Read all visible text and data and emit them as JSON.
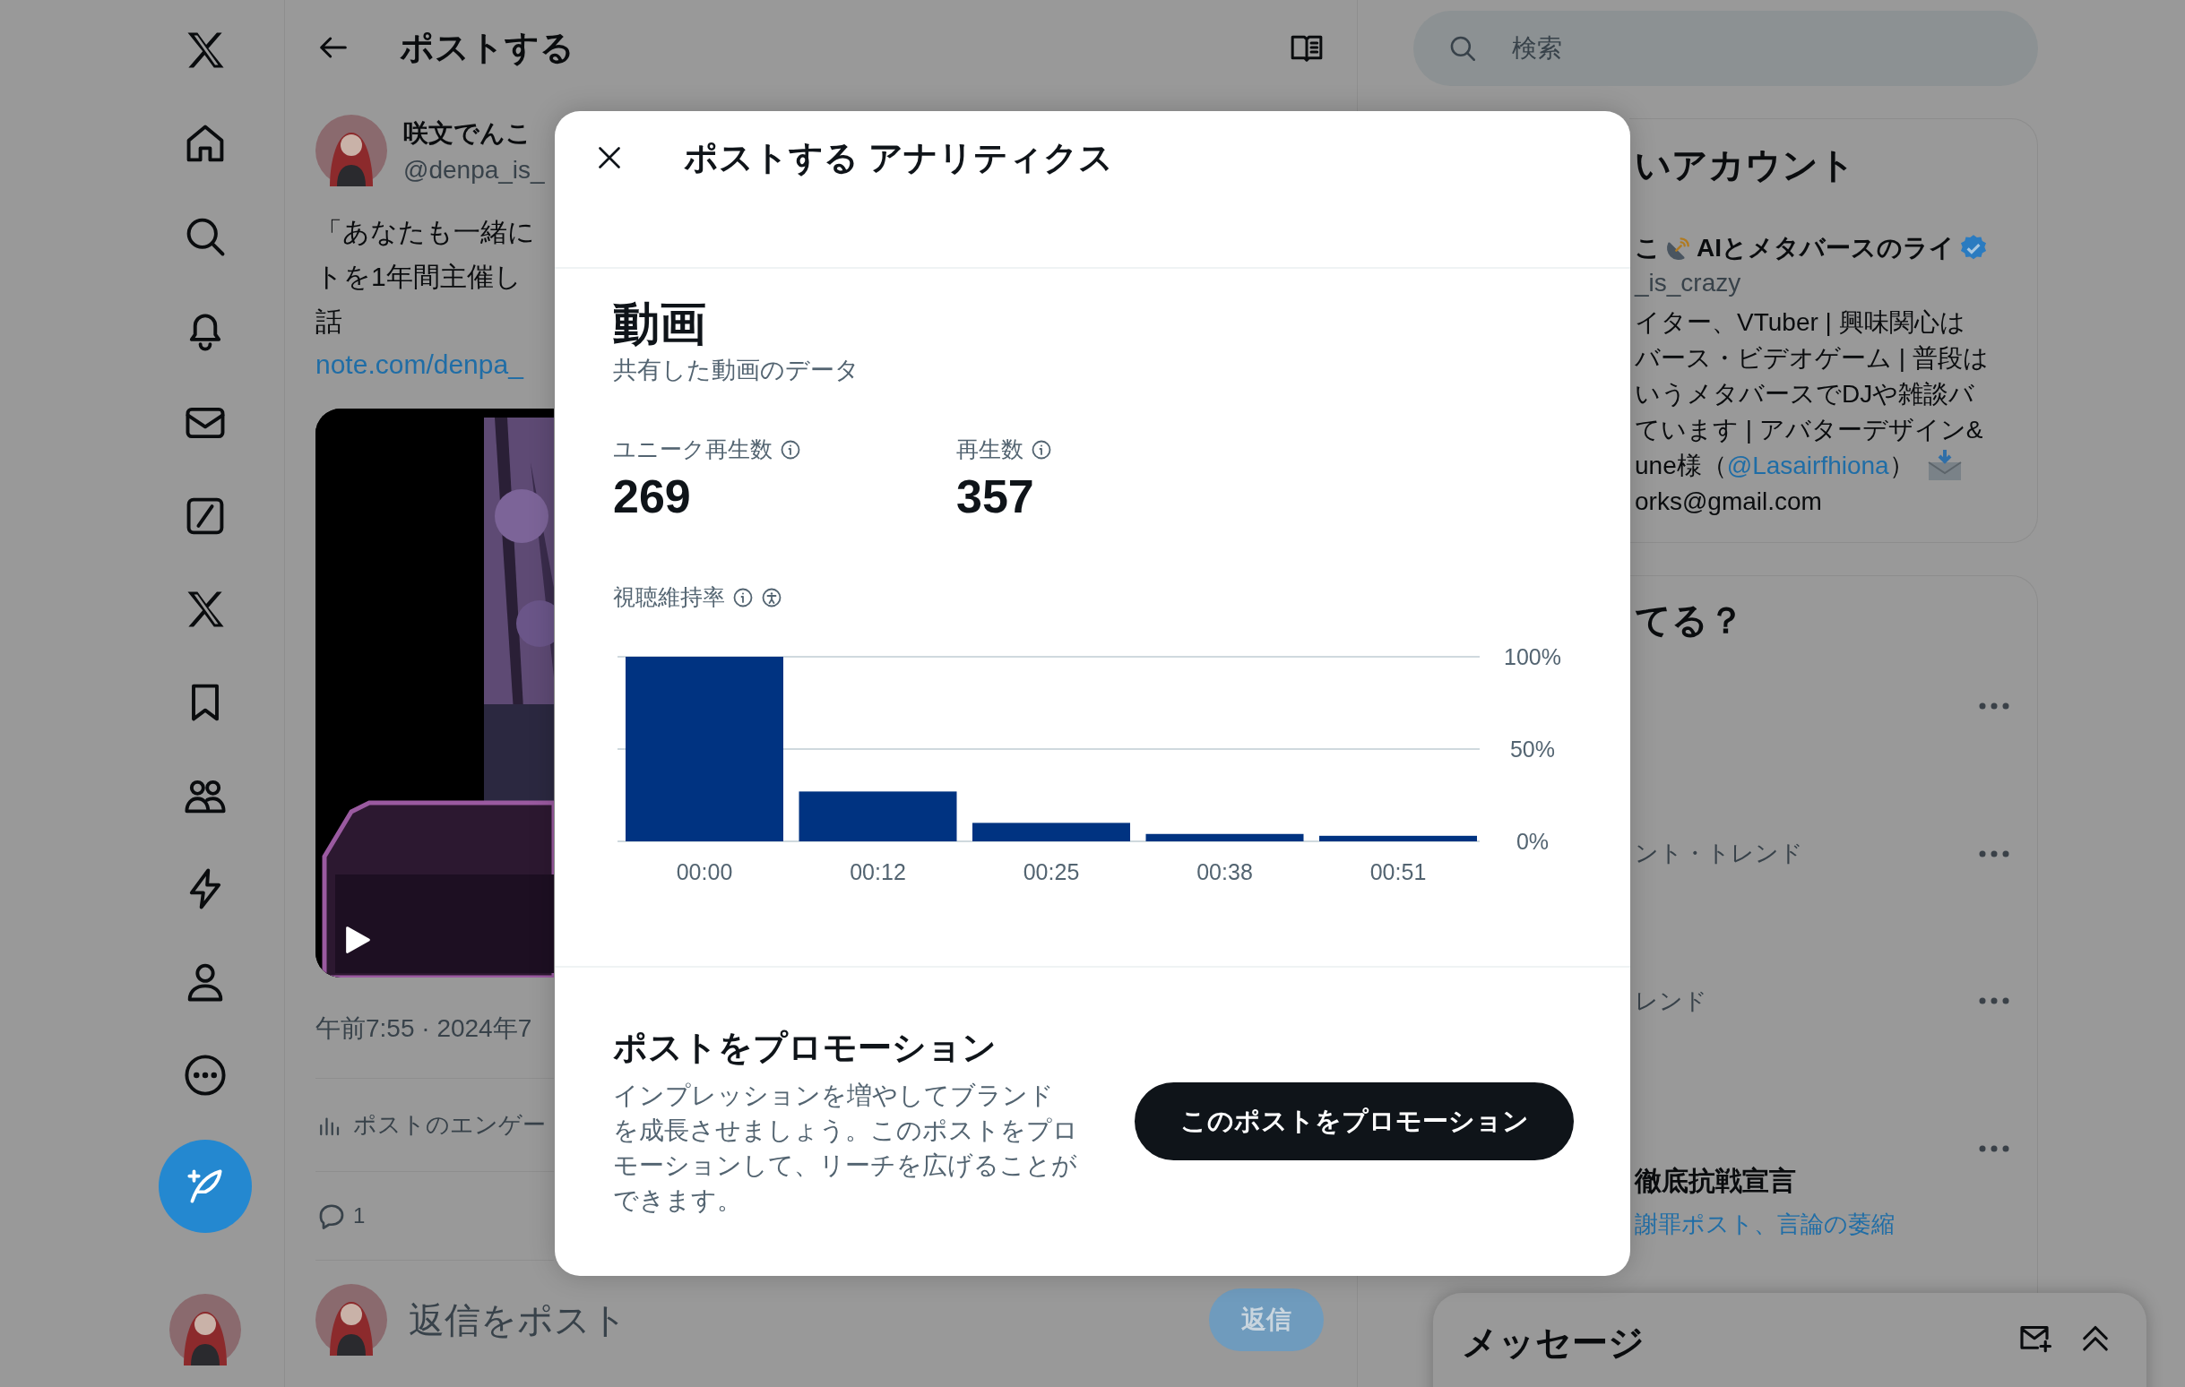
{
  "header": {
    "title": "ポストする"
  },
  "post": {
    "author_name": "咲文でんこ",
    "handle": "@denpa_is_",
    "text_lines": [
      "「あなたも一緒に",
      "トを1年間主催し",
      "話"
    ],
    "link": "note.com/denpa_",
    "video": {
      "kind": "picture"
    },
    "timestamp": "午前7:55 · 2024年7",
    "engagement_link": "ポストのエンゲー",
    "reply_count": "1"
  },
  "reply_box": {
    "placeholder": "返信をポスト",
    "button": "返信"
  },
  "search": {
    "placeholder": "検索"
  },
  "account_card": {
    "title": "いアカウント",
    "name_start": "こ",
    "name_rest": "AIとメタバースのライ",
    "handle": "_is_crazy",
    "bio_lines": [
      "イター、VTuber | 興味関心は",
      "バース・ビデオゲーム | 普段は",
      "いうメタバースでDJや雑談バ",
      "ています | アバターデザイン&"
    ],
    "mention_before": "une様（",
    "mention": "@Lasairfhiona",
    "mention_after": "）",
    "email": "orks@gmail.com"
  },
  "trends_card": {
    "title": "てる？",
    "trends": [
      {
        "kind": "trend"
      },
      {
        "kind": "trend",
        "meta": "ント・トレンド"
      },
      {
        "kind": "trend",
        "meta": "レンド"
      },
      {
        "kind": "trend",
        "title": "徹底抗戦宣言",
        "related": "謝罪ポスト、言論の萎縮"
      }
    ]
  },
  "messages_drawer": {
    "title": "メッセージ"
  },
  "analytics_modal": {
    "title": "ポストする アナリティクス",
    "section": {
      "title": "動画",
      "subtitle": "共有した動画のデータ"
    },
    "metrics": [
      {
        "label": "ユニーク再生数",
        "value": "269"
      },
      {
        "label": "再生数",
        "value": "357"
      }
    ],
    "retention": {
      "label": "視聴維持率",
      "chart_data": {
        "type": "bar",
        "categories": [
          "00:00",
          "00:12",
          "00:25",
          "00:38",
          "00:51"
        ],
        "series": [
          {
            "color": "#003381",
            "values": [
              100,
              27,
              10,
              4,
              3
            ]
          }
        ],
        "ylim": [
          0,
          100
        ],
        "yticks": [
          {
            "value": 0,
            "label": "0%"
          },
          {
            "value": 50,
            "label": "50%"
          },
          {
            "value": 100,
            "label": "100%"
          }
        ]
      }
    },
    "promotion": {
      "title": "ポストをプロモーション",
      "description": "インプレッションを増やしてブランドを成長させましょう。このポストをプロモーションして、リーチを広げることができます。",
      "button": "このポストをプロモーション"
    }
  }
}
